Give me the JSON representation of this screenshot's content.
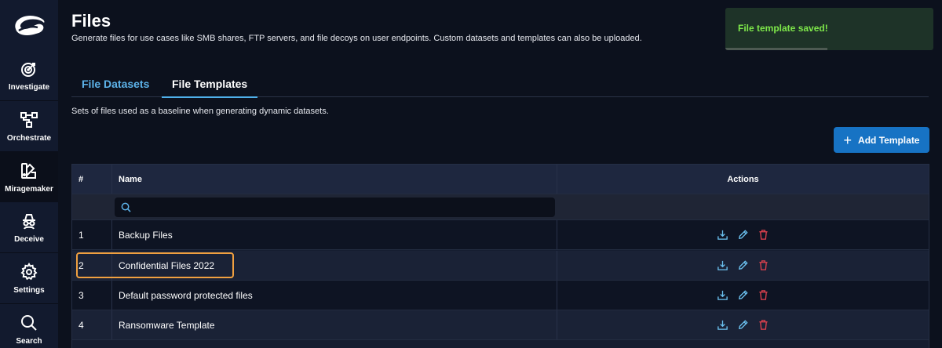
{
  "sidebar": {
    "items": [
      {
        "label": "Investigate",
        "icon": "target-icon"
      },
      {
        "label": "Orchestrate",
        "icon": "flow-icon"
      },
      {
        "label": "Miragemaker",
        "icon": "palette-icon"
      },
      {
        "label": "Deceive",
        "icon": "spy-icon"
      },
      {
        "label": "Settings",
        "icon": "gear-icon"
      },
      {
        "label": "Search",
        "icon": "search-icon"
      }
    ],
    "active": "Miragemaker"
  },
  "header": {
    "title": "Files",
    "description": "Generate files for use cases like SMB shares, FTP servers, and file decoys on user endpoints. Custom datasets and templates can also be uploaded."
  },
  "toast": {
    "message": "File template saved!",
    "progress": 0.49
  },
  "tabs": [
    {
      "label": "File Datasets",
      "active": false
    },
    {
      "label": "File Templates",
      "active": true
    }
  ],
  "section": {
    "description": "Sets of files used as a baseline when generating dynamic datasets."
  },
  "add_button": {
    "label": "Add Template"
  },
  "table": {
    "columns": {
      "num": "#",
      "name": "Name",
      "actions": "Actions"
    },
    "search_placeholder": "",
    "rows": [
      {
        "num": "1",
        "name": "Backup Files"
      },
      {
        "num": "2",
        "name": "Confidential Files 2022"
      },
      {
        "num": "3",
        "name": "Default password protected files"
      },
      {
        "num": "4",
        "name": "Ransomware Template"
      }
    ]
  },
  "colors": {
    "accent": "#1773c4",
    "tab_active_underline": "#4fb0ea",
    "toast_text": "#7ee84a",
    "delete_icon": "#e2424f",
    "edit_icon": "#6cc3f2",
    "highlight": "#f0a040"
  }
}
